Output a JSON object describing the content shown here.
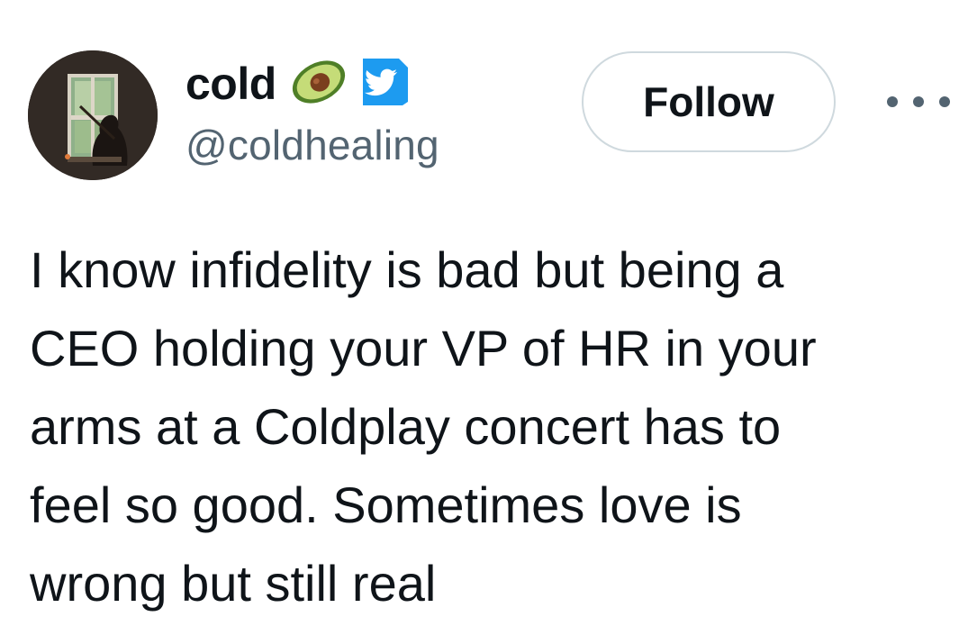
{
  "author": {
    "display_name": "cold",
    "emoji_icon": "avocado-icon",
    "badge_icon": "twitter-bird-badge-icon",
    "handle": "@coldhealing",
    "avatar_icon": "window-silhouette-avatar"
  },
  "actions": {
    "follow_label": "Follow",
    "more_icon": "more-horizontal-icon"
  },
  "tweet": {
    "lines": [
      "I know infidelity is bad but being a",
      "CEO holding your VP of HR in your",
      "arms at a Coldplay concert has to",
      "feel so good. Sometimes love is",
      "wrong but still real"
    ]
  },
  "colors": {
    "text": "#0f1419",
    "secondary": "#536471",
    "border": "#cfd9de",
    "badge": "#1d9bf0"
  }
}
